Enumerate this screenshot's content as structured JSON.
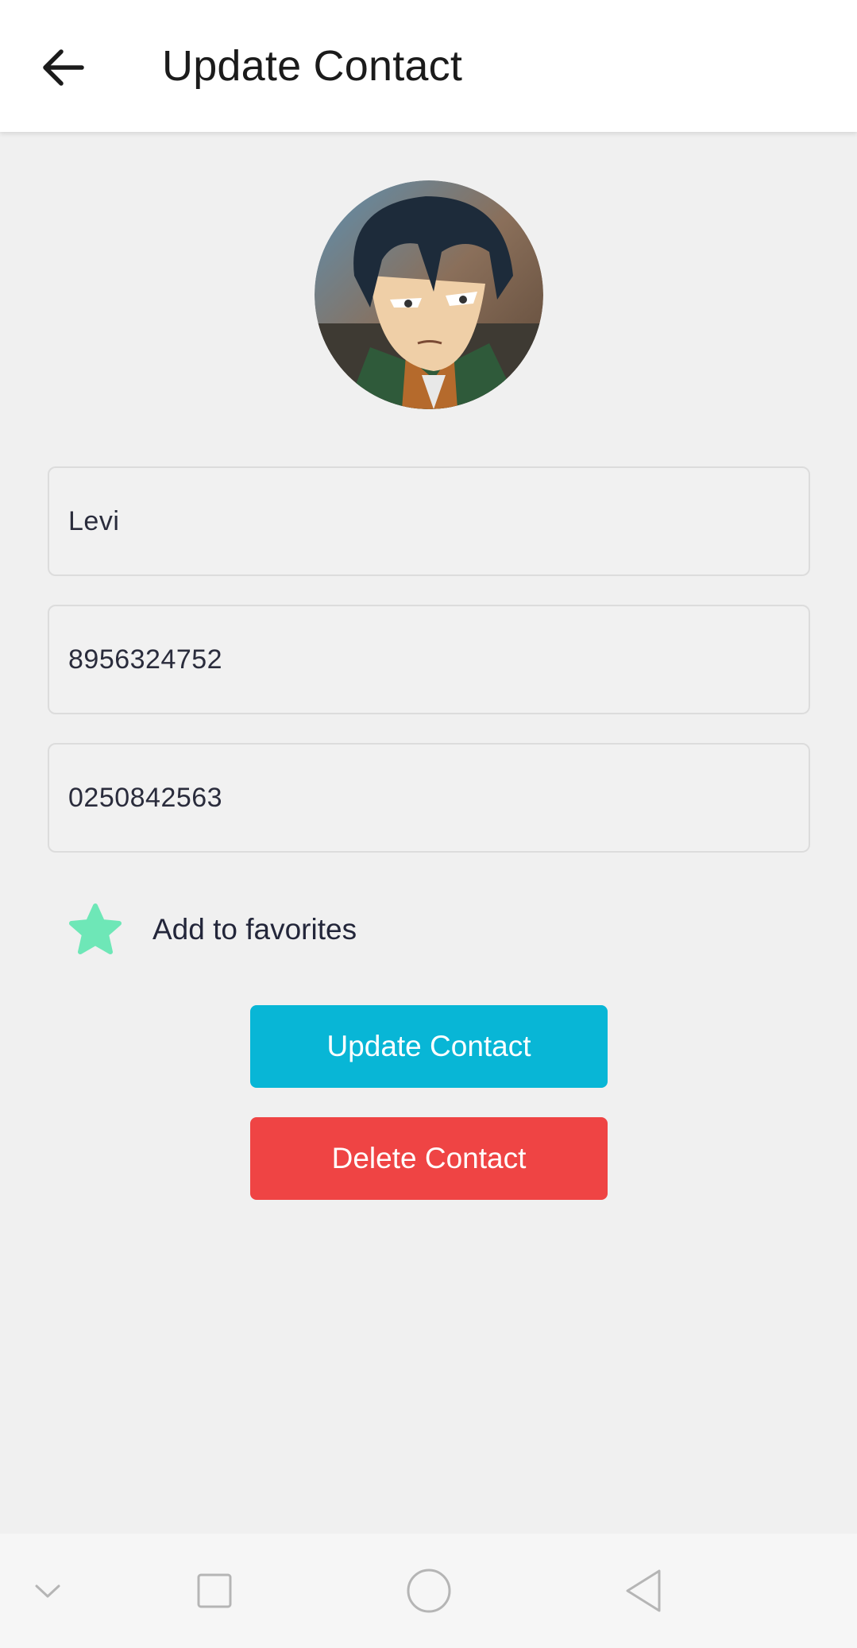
{
  "header": {
    "title": "Update Contact",
    "back_icon": "arrow-left-icon"
  },
  "contact": {
    "avatar_icon": "contact-photo",
    "name": "Levi",
    "phone": "8956324752",
    "phone_secondary": "0250842563"
  },
  "favorite": {
    "label": "Add to favorites",
    "icon": "star-icon",
    "icon_color": "#6ee7b7"
  },
  "actions": {
    "update_label": "Update Contact",
    "update_color": "#08b6d6",
    "delete_label": "Delete Contact",
    "delete_color": "#ef4444"
  },
  "system_nav": {
    "icons": [
      "chevron-down-icon",
      "square-icon",
      "circle-icon",
      "triangle-back-icon"
    ]
  }
}
